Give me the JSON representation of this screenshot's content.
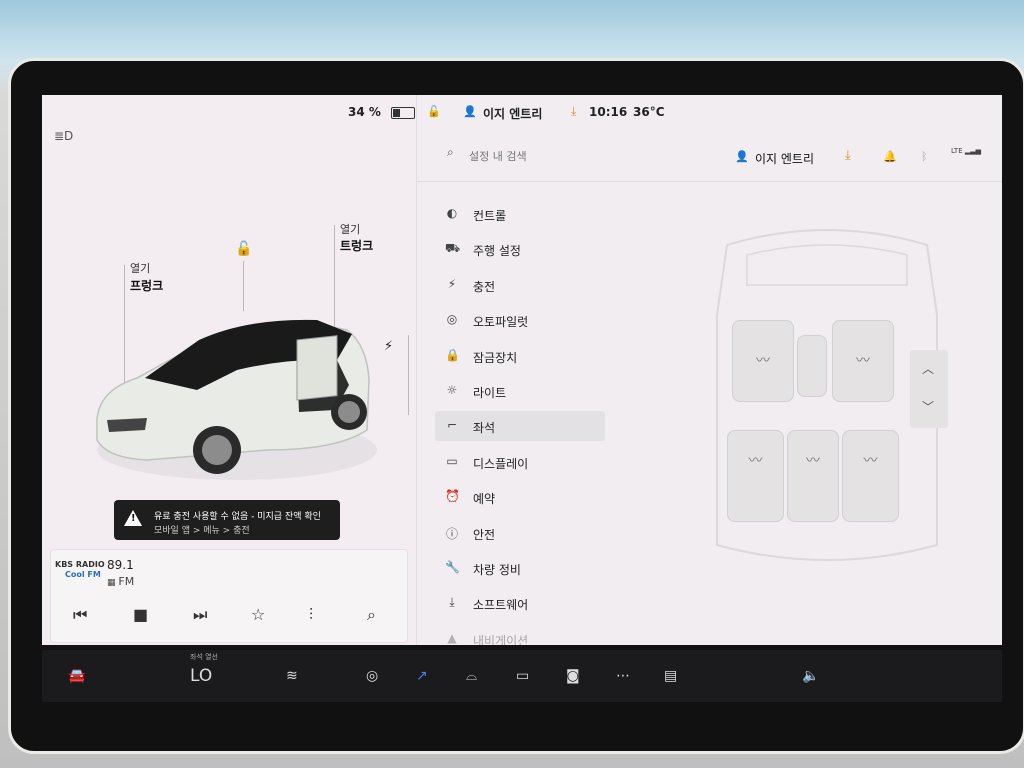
{
  "status_bar": {
    "battery_percent": "34 %",
    "battery_level": 0.34,
    "profile_name": "이지 엔트리",
    "time": "10:16",
    "temperature": "36°C"
  },
  "car_panel": {
    "frunk_label_top": "열기",
    "frunk_label": "프렁크",
    "trunk_label_top": "열기",
    "trunk_label": "트렁크",
    "alert_line1": "유료 충전 사용할 수 없음 - 미지급 잔액 확인",
    "alert_line2": "모바일 앱 > 메뉴 > 충전"
  },
  "media": {
    "station_logo_line1": "KBS RADIO",
    "station_logo_line2": "Cool FM",
    "frequency": "89.1",
    "band": "FM"
  },
  "settings": {
    "search_placeholder": "설정 내 검색",
    "profile_name": "이지 엔트리",
    "signal_label": "LTE",
    "menu": [
      {
        "label": "컨트롤",
        "icon": "toggle-icon"
      },
      {
        "label": "주행 설정",
        "icon": "car-icon"
      },
      {
        "label": "충전",
        "icon": "bolt-icon"
      },
      {
        "label": "오토파일럿",
        "icon": "steering-wheel-icon"
      },
      {
        "label": "잠금장치",
        "icon": "lock-icon"
      },
      {
        "label": "라이트",
        "icon": "sun-icon"
      },
      {
        "label": "좌석",
        "icon": "seat-icon"
      },
      {
        "label": "디스플레이",
        "icon": "display-icon"
      },
      {
        "label": "예약",
        "icon": "alarm-icon"
      },
      {
        "label": "안전",
        "icon": "warning-icon"
      },
      {
        "label": "차량 정비",
        "icon": "wrench-icon"
      },
      {
        "label": "소프트웨어",
        "icon": "download-icon"
      },
      {
        "label": "내비게이션",
        "icon": "navigation-icon"
      }
    ],
    "active_item": "좌석"
  },
  "taskbar": {
    "climate_label": "좌석 열선",
    "temperature": "LO"
  }
}
